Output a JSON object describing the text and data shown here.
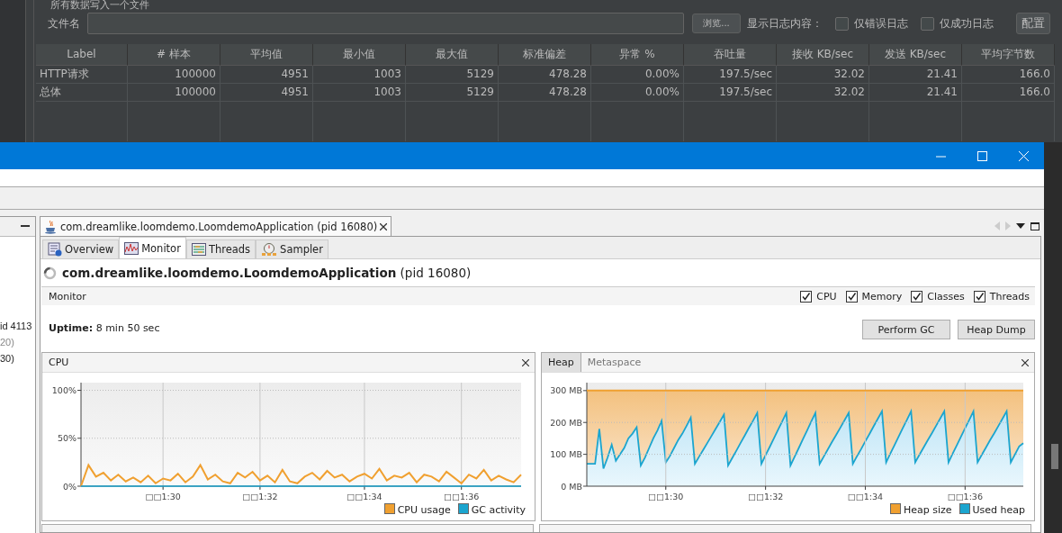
{
  "jmeter": {
    "section_title": "所有数据写入一个文件",
    "filename_label": "文件名",
    "browse_button": "浏览...",
    "log_label": "显示日志内容：",
    "log_options": [
      {
        "label": "仅错误日志",
        "checked": false
      },
      {
        "label": "仅成功日志",
        "checked": false
      }
    ],
    "config_button": "配置"
  },
  "results_table": {
    "columns": [
      "Label",
      "# 样本",
      "平均值",
      "最小值",
      "最大值",
      "标准偏差",
      "异常 %",
      "吞吐量",
      "接收 KB/sec",
      "发送 KB/sec",
      "平均字节数"
    ],
    "rows": [
      [
        "HTTP请求",
        "100000",
        "4951",
        "1003",
        "5129",
        "478.28",
        "0.00%",
        "197.5/sec",
        "32.02",
        "21.41",
        "166.0"
      ],
      [
        "总体",
        "100000",
        "4951",
        "1003",
        "5129",
        "478.28",
        "0.00%",
        "197.5/sec",
        "32.02",
        "21.41",
        "166.0"
      ]
    ]
  },
  "visualvm": {
    "sidebar": {
      "items": [
        {
          "text": "id 4113",
          "muted": false
        },
        {
          "text": "20)",
          "muted": true
        },
        {
          "text": "30)",
          "muted": false
        }
      ]
    },
    "document_tabs": [
      {
        "label": "com.dreamlike.loomdemo.LoomdemoApplication (pid 16080)",
        "selected": true
      }
    ],
    "view_tabs": [
      {
        "label": "Overview",
        "kind": "overview",
        "selected": false
      },
      {
        "label": "Monitor",
        "kind": "monitor",
        "selected": true
      },
      {
        "label": "Threads",
        "kind": "threads",
        "selected": false
      },
      {
        "label": "Sampler",
        "kind": "sampler",
        "selected": false
      }
    ],
    "app_title": "com.dreamlike.loomdemo.LoomdemoApplication",
    "app_pid": "(pid 16080)",
    "monitor": {
      "title": "Monitor",
      "options": [
        {
          "label": "CPU",
          "checked": true
        },
        {
          "label": "Memory",
          "checked": true
        },
        {
          "label": "Classes",
          "checked": true
        },
        {
          "label": "Threads",
          "checked": true
        }
      ],
      "uptime_label": "Uptime:",
      "uptime": "8 min 50 sec",
      "buttons": [
        "Perform GC",
        "Heap Dump"
      ]
    },
    "panels": [
      {
        "tabs": [
          {
            "label": "CPU",
            "selected": true
          }
        ],
        "chart_data": {
          "type": "line",
          "ylim": [
            0,
            108
          ],
          "grid": true,
          "legend": true,
          "categories": [
            null,
            null,
            null,
            null,
            null,
            null,
            null,
            null,
            null,
            null,
            null,
            "□□1:30",
            null,
            null,
            null,
            null,
            null,
            null,
            null,
            null,
            null,
            null,
            null,
            null,
            "□□1:32",
            null,
            null,
            null,
            null,
            null,
            null,
            null,
            null,
            null,
            null,
            null,
            null,
            null,
            "□□1:34",
            null,
            null,
            null,
            null,
            null,
            null,
            null,
            null,
            null,
            null,
            null,
            null,
            "□□1:36",
            null,
            null,
            null,
            null,
            null,
            null,
            null,
            null
          ],
          "yticks": [
            {
              "value": 0,
              "label": "0%"
            },
            {
              "value": 50,
              "label": "50%"
            },
            {
              "value": 100,
              "label": "100%"
            }
          ],
          "series": [
            {
              "name": "CPU usage",
              "color": "#f0a030",
              "values": [
                0,
                22,
                10,
                14,
                6,
                12,
                5,
                9,
                4,
                11,
                3,
                8,
                6,
                13,
                4,
                10,
                22,
                7,
                12,
                5,
                3,
                14,
                9,
                15,
                6,
                11,
                4,
                17,
                5,
                3,
                10,
                14,
                7,
                16,
                9,
                12,
                5,
                10,
                13,
                8,
                18,
                6,
                11,
                9,
                14,
                4,
                12,
                10,
                5,
                15,
                9,
                3,
                12,
                8,
                17,
                6,
                11,
                7,
                4,
                12
              ]
            },
            {
              "name": "GC activity",
              "color": "#1ba5cf",
              "values": [
                0,
                0,
                0,
                0,
                0,
                0,
                0,
                0,
                0,
                0,
                0,
                0,
                0,
                0,
                0,
                0,
                0,
                0,
                0,
                0,
                0,
                0,
                0,
                0,
                0,
                0,
                0,
                0,
                0,
                0,
                0,
                0,
                0,
                0,
                0,
                0,
                0,
                0,
                0,
                0,
                0,
                0,
                0,
                0,
                0,
                0,
                0,
                0,
                0,
                0,
                0,
                0,
                0,
                0,
                0,
                0,
                0,
                0,
                0,
                0
              ]
            }
          ]
        }
      },
      {
        "tabs": [
          {
            "label": "Heap",
            "selected": true
          },
          {
            "label": "Metaspace",
            "selected": false
          }
        ],
        "chart_data": {
          "type": "area",
          "grid": true,
          "legend": true,
          "ylim": [
            0,
            325
          ],
          "categories": [
            null,
            null,
            null,
            null,
            null,
            null,
            null,
            null,
            null,
            null,
            null,
            null,
            null,
            null,
            null,
            null,
            null,
            null,
            null,
            "□□1:30",
            null,
            null,
            null,
            null,
            null,
            null,
            null,
            null,
            null,
            null,
            null,
            null,
            null,
            null,
            null,
            null,
            null,
            null,
            null,
            null,
            null,
            null,
            null,
            "□□1:32",
            null,
            null,
            null,
            null,
            null,
            null,
            null,
            null,
            null,
            null,
            null,
            null,
            null,
            null,
            null,
            null,
            null,
            null,
            null,
            null,
            null,
            null,
            null,
            "□□1:34",
            null,
            null,
            null,
            null,
            null,
            null,
            null,
            null,
            null,
            null,
            null,
            null,
            null,
            null,
            null,
            null,
            null,
            null,
            null,
            null,
            null,
            null,
            null,
            "□□1:36",
            null,
            null,
            null,
            null,
            null,
            null,
            null,
            null,
            null,
            null,
            null,
            null,
            null,
            null
          ],
          "yticks": [
            {
              "value": 0,
              "label": "0 MB"
            },
            {
              "value": 100,
              "label": "100 MB"
            },
            {
              "value": 200,
              "label": "200 MB"
            },
            {
              "value": 300,
              "label": "300 MB"
            }
          ],
          "series": [
            {
              "name": "Heap size",
              "type": "line",
              "color": "#f0a030",
              "values": [
                300,
                300,
                300,
                300,
                300,
                300,
                300,
                300,
                300,
                300,
                300,
                300,
                300,
                300,
                300,
                300,
                300,
                300,
                300,
                300,
                300,
                300,
                300,
                300,
                300,
                300,
                300,
                300,
                300,
                300,
                300,
                300,
                300,
                300,
                300,
                300,
                300,
                300,
                300,
                300,
                300,
                300,
                300,
                300,
                300,
                300,
                300,
                300,
                300,
                300,
                300,
                300,
                300,
                300,
                300,
                300,
                300,
                300,
                300,
                300,
                300,
                300,
                300,
                300,
                300,
                300,
                300,
                300,
                300,
                300,
                300,
                300,
                300,
                300,
                300,
                300,
                300,
                300,
                300,
                300,
                300,
                300,
                300,
                300,
                300,
                300,
                300,
                300,
                300,
                300,
                300,
                300,
                300,
                300,
                300,
                300,
                300,
                300,
                300,
                300,
                300,
                300,
                300,
                300,
                300,
                300
              ]
            },
            {
              "name": "Used heap",
              "type": "area",
              "color": "#1ba5cf",
              "values": [
                70,
                70,
                70,
                180,
                55,
                90,
                130,
                80,
                100,
                120,
                150,
                165,
                185,
                65,
                90,
                120,
                150,
                175,
                205,
                75,
                95,
                120,
                145,
                165,
                190,
                215,
                70,
                92,
                114,
                136,
                158,
                180,
                202,
                225,
                65,
                89,
                112,
                136,
                159,
                183,
                206,
                230,
                70,
                97,
                123,
                150,
                177,
                203,
                230,
                65,
                93,
                120,
                148,
                175,
                203,
                230,
                70,
                93,
                116,
                139,
                161,
                184,
                207,
                230,
                70,
                94,
                117,
                141,
                164,
                188,
                211,
                235,
                75,
                102,
                128,
                155,
                182,
                208,
                235,
                75,
                98,
                121,
                144,
                166,
                189,
                212,
                235,
                75,
                102,
                128,
                155,
                182,
                208,
                235,
                75,
                98,
                121,
                144,
                166,
                189,
                212,
                235,
                75,
                100,
                125,
                135
              ]
            }
          ]
        }
      }
    ]
  }
}
